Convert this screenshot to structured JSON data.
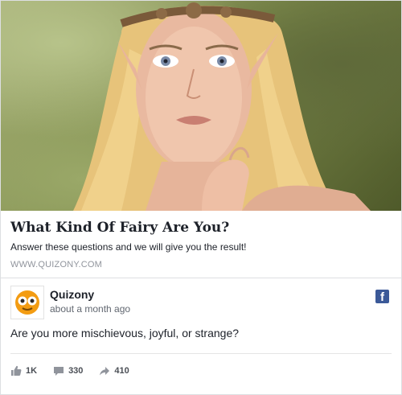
{
  "link_preview": {
    "title": "What Kind Of Fairy Are You?",
    "description": "Answer these questions and we will give you the result!",
    "domain": "WWW.QUIZONY.COM"
  },
  "post": {
    "page_name": "Quizony",
    "timestamp": "about a month ago",
    "text": "Are you more mischievous, joyful, or strange?",
    "platform_icon": "facebook-icon",
    "platform_glyph": "f"
  },
  "actions": {
    "likes": "1K",
    "comments": "330",
    "shares": "410"
  },
  "colors": {
    "facebook_blue": "#3b5998",
    "quizony_orange": "#f39c12",
    "muted_text": "#90949c"
  }
}
